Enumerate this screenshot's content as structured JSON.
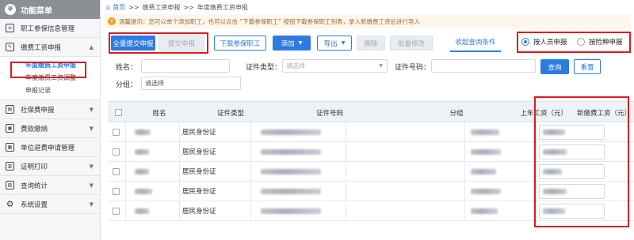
{
  "sidebar": {
    "title": "功能菜单",
    "logo_glyph": "¥",
    "items": [
      {
        "label": "职工参保信息管理",
        "icon": "id-card-icon"
      },
      {
        "label": "缴费工资申报",
        "icon": "edit-icon",
        "expanded": true
      },
      {
        "label": "社保费申报",
        "icon": "document-icon"
      },
      {
        "label": "费款缴纳",
        "icon": "wallet-icon"
      },
      {
        "label": "单位退费申请管理",
        "icon": "refund-icon"
      },
      {
        "label": "证明打印",
        "icon": "print-icon"
      },
      {
        "label": "查询统计",
        "icon": "chart-icon"
      },
      {
        "label": "系统设置",
        "icon": "gear-icon"
      }
    ],
    "subitems": [
      {
        "label": "年度缴费工资申报",
        "active": true
      },
      {
        "label": "年度缴费工资调整",
        "active": false
      },
      {
        "label": "申报记录",
        "active": false
      }
    ]
  },
  "breadcrumb": {
    "home": "首页",
    "sep": ">>",
    "level1": "缴费工资申报",
    "level2": "年度缴费工资申报"
  },
  "notice": {
    "text": "温馨提示：您可以单个添加职工，也可以点击 “下载参保职工” 按钮下载参保职工列表，录入新缴费工资后进行导入"
  },
  "toolbar": {
    "submit_all": "全量提交申报",
    "submit": "提交申报",
    "download": "下载参保职工",
    "add": "添加",
    "export": "导出",
    "delete": "删除",
    "batch_edit": "批量修改",
    "collapse_query": "收起查询条件",
    "radio_by_person": "按人员申报",
    "radio_by_insurance": "按险种申报",
    "selected_mode": "by_person"
  },
  "form": {
    "name_label": "姓名：",
    "id_type_label": "证件类型：",
    "id_type_placeholder": "请选择",
    "id_no_label": "证件号码：",
    "group_label": "分组：",
    "group_placeholder": "请选择",
    "query": "查询",
    "reset": "重置"
  },
  "table": {
    "headers": [
      "姓名",
      "证件类型",
      "证件号码",
      "分组",
      "上年工资（元）",
      "新缴费工资（元）"
    ],
    "rows": [
      {
        "id_type": "居民身份证"
      },
      {
        "id_type": "居民身份证"
      },
      {
        "id_type": "居民身份证"
      },
      {
        "id_type": "居民身份证"
      },
      {
        "id_type": "居民身份证"
      }
    ]
  },
  "colors": {
    "accent": "#2e7be0",
    "highlight_red": "#e0191f",
    "sidebar_bg": "#f4f6f8",
    "notice_bg": "#fdf6ec"
  }
}
